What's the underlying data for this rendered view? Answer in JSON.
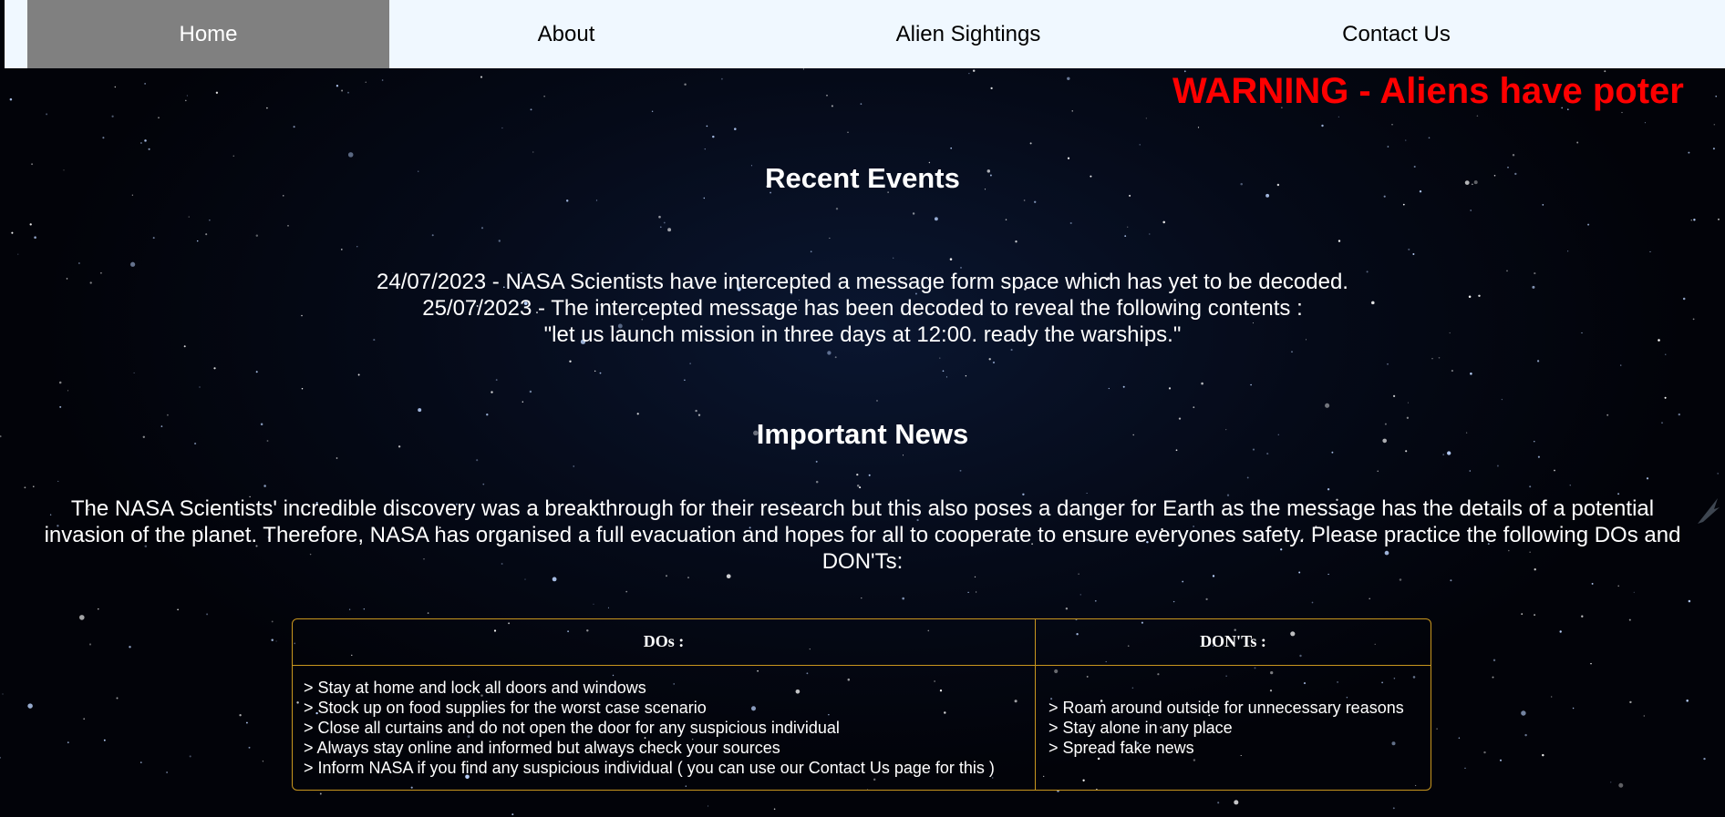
{
  "nav": {
    "items": [
      {
        "label": "Home",
        "active": true
      },
      {
        "label": "About",
        "active": false
      },
      {
        "label": "Alien Sightings",
        "active": false
      },
      {
        "label": "Contact Us",
        "active": false
      }
    ]
  },
  "warning": {
    "text": "WARNING - Aliens have poter"
  },
  "recent_events": {
    "title": "Recent Events",
    "lines": [
      "24/07/2023 - NASA Scientists have intercepted a message form space which has yet to be decoded.",
      "25/07/2023 - The intercepted message has been decoded to reveal the following contents :",
      "\"let us launch mission in three days at 12:00. ready the warships.\""
    ]
  },
  "important_news": {
    "title": "Important News",
    "paragraph_lines": [
      "The NASA Scientists' incredible discovery was a breakthrough for their research but this also poses a danger for Earth as the message has the details of a potential",
      "invasion of the planet. Therefore, NASA has organised a full evacuation and hopes for all to cooperate to ensure everyones safety. Please practice the following DOs and",
      "DON'Ts:"
    ]
  },
  "rules_table": {
    "dos_header": "DOs :",
    "donts_header": "DON'Ts :",
    "dos": [
      "> Stay at home and lock all doors and windows",
      "> Stock up on food supplies for the worst case scenario",
      "> Close all curtains and do not open the door for any suspicious individual",
      "> Always stay online and informed but always check your sources",
      "> Inform NASA if you find any suspicious individual ( you can use our Contact Us page for this )"
    ],
    "donts": [
      "> Roam around outside for unnecessary reasons",
      "> Stay alone in any place",
      "> Spread fake news"
    ]
  },
  "colors": {
    "nav_bg": "#f0f8ff",
    "nav_active": "#808080",
    "warning": "#ff0000",
    "table_border": "#c8961e"
  },
  "icons": {
    "edge": "feather-icon"
  }
}
